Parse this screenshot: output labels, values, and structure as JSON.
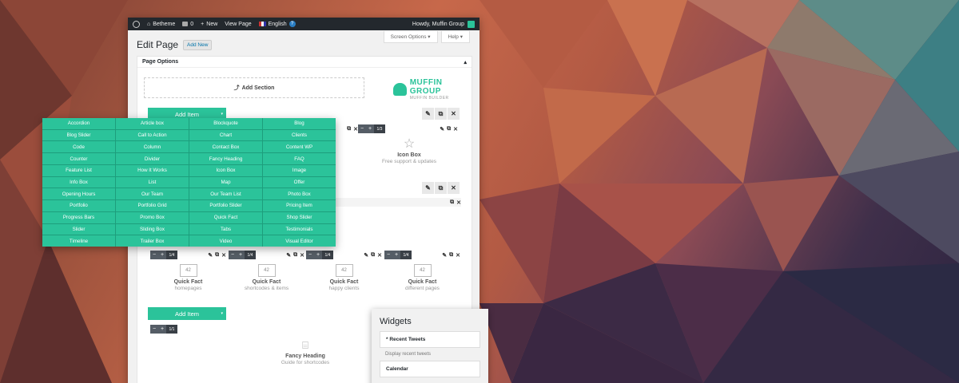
{
  "adminbar": {
    "site": "Betheme",
    "comments": "0",
    "new": "New",
    "view": "View Page",
    "lang": "English",
    "greeting": "Howdy, Muffin Group"
  },
  "screen_options": "Screen Options",
  "help": "Help",
  "page_title": "Edit Page",
  "add_new": "Add New",
  "page_options": "Page Options",
  "add_section": "Add Section",
  "brand": {
    "name": "MUFFIN GROUP",
    "sub": "MUFFIN BUILDER"
  },
  "add_item": "Add Item",
  "size_labels": {
    "third": "1/3",
    "quarter": "1/4",
    "full": "1/1"
  },
  "icon_box": {
    "name": "Icon Box",
    "desc": "Free support & updates"
  },
  "quick_facts": [
    {
      "name": "Quick Fact",
      "desc": "homepages"
    },
    {
      "name": "Quick Fact",
      "desc": "shortcodes & items"
    },
    {
      "name": "Quick Fact",
      "desc": "happy clients"
    },
    {
      "name": "Quick Fact",
      "desc": "different pages"
    }
  ],
  "quick_fact_number": "42",
  "fancy_heading": {
    "name": "Fancy Heading",
    "desc": "Guide for shortcodes"
  },
  "menu_items": [
    "Accordion",
    "Article box",
    "Blockquote",
    "Blog",
    "Blog Slider",
    "Call to Action",
    "Chart",
    "Clients",
    "Code",
    "Column",
    "Contact Box",
    "Content WP",
    "Counter",
    "Divider",
    "Fancy Heading",
    "FAQ",
    "Feature List",
    "How It Works",
    "Icon Box",
    "Image",
    "Info Box",
    "List",
    "Map",
    "Offer",
    "Opening Hours",
    "Our Team",
    "Our Team List",
    "Photo Box",
    "Portfolio",
    "Portfolio Grid",
    "Portfolio Slider",
    "Pricing Item",
    "Progress Bars",
    "Promo Box",
    "Quick Fact",
    "Shop Slider",
    "Slider",
    "Sliding Box",
    "Tabs",
    "Testimonials",
    "Timeline",
    "Trailer Box",
    "Video",
    "Visual Editor"
  ],
  "widgets": {
    "title": "Widgets",
    "w1": "* Recent Tweets",
    "w1_desc": "Display recent tweets",
    "w2": "Calendar"
  }
}
